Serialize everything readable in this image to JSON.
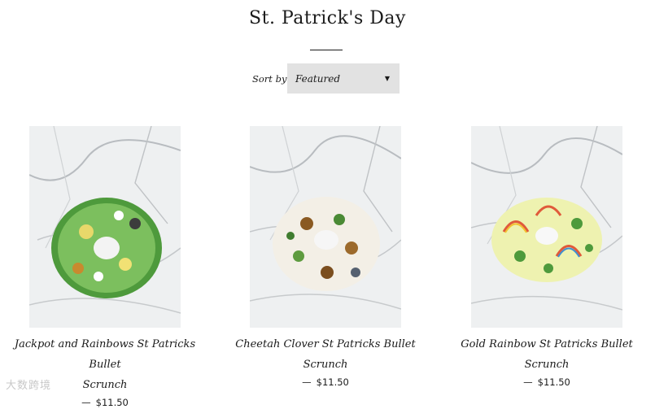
{
  "collection": {
    "title": "St. Patrick's Day"
  },
  "sort": {
    "label": "Sort by",
    "selected": "Featured"
  },
  "products": [
    {
      "title_line1": "Jackpot and Rainbows St Patricks Bullet",
      "title_line2": "Scrunch",
      "dash": "—",
      "price": "$11.50"
    },
    {
      "title_line1": "Cheetah Clover St Patricks Bullet",
      "title_line2": "Scrunch",
      "dash": "—",
      "price": "$11.50"
    },
    {
      "title_line1": "Gold Rainbow St Patricks Bullet Scrunch",
      "title_line2": "",
      "dash": "—",
      "price": "$11.50"
    }
  ],
  "watermark": {
    "text": "大数跨境"
  },
  "icons": {
    "sort_caret": "caret-down-icon"
  },
  "colors": {
    "sort_bg": "#e2e2e2",
    "text": "#1a1a1a"
  }
}
